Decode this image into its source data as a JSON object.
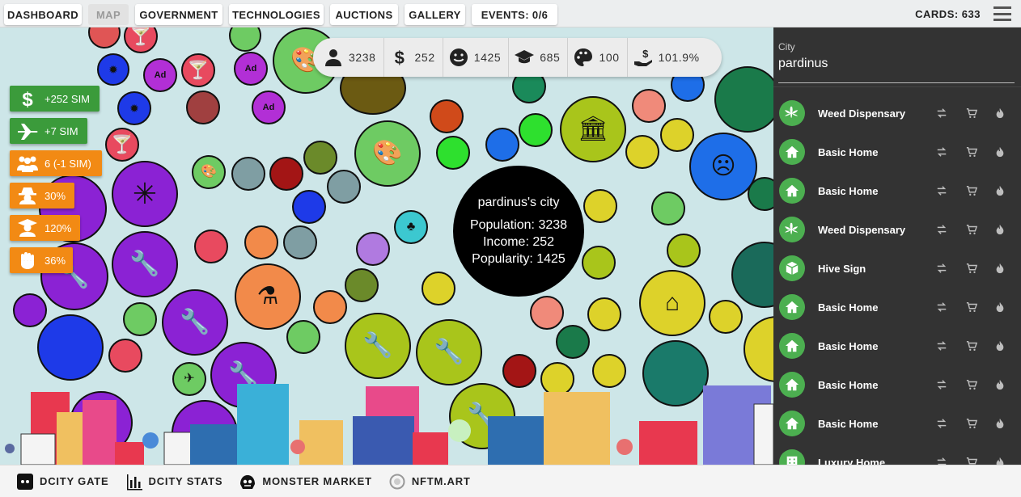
{
  "nav": {
    "dashboard": "DASHBOARD",
    "map": "MAP",
    "government": "GOVERNMENT",
    "technologies": "TECHNOLOGIES",
    "auctions": "AUCTIONS",
    "gallery": "GALLERY",
    "events": "EVENTS: 0/6",
    "cards": "CARDS: 633"
  },
  "stats": {
    "population": "3238",
    "income": "252",
    "popularity": "1425",
    "education": "685",
    "culture": "100",
    "tax": "101.9%"
  },
  "sidepills": [
    {
      "label": "+252 SIM",
      "icon": "dollar-icon",
      "color": "#3b9b3b"
    },
    {
      "label": "+7 SIM",
      "icon": "airplane-icon",
      "color": "#3b9b3b"
    },
    {
      "label": "6 (-1 SIM)",
      "icon": "people-icon",
      "color": "#f28a14"
    },
    {
      "label": "30%",
      "icon": "spy-icon",
      "color": "#f28a14"
    },
    {
      "label": "120%",
      "icon": "graduate-icon",
      "color": "#f28a14"
    },
    {
      "label": "36%",
      "icon": "fist-icon",
      "color": "#f28a14"
    }
  ],
  "cityinfo": {
    "title": "pardinus's city",
    "population": "Population: 3238",
    "income": "Income: 252",
    "popularity": "Popularity: 1425"
  },
  "panel": {
    "city_label": "City",
    "city_value": "pardinus",
    "items": [
      {
        "name": "Weed Dispensary",
        "icon": "leaf-icon"
      },
      {
        "name": "Basic Home",
        "icon": "home-icon"
      },
      {
        "name": "Basic Home",
        "icon": "home-icon"
      },
      {
        "name": "Weed Dispensary",
        "icon": "leaf-icon"
      },
      {
        "name": "Hive Sign",
        "icon": "cube-icon"
      },
      {
        "name": "Basic Home",
        "icon": "home-icon"
      },
      {
        "name": "Basic Home",
        "icon": "home-icon"
      },
      {
        "name": "Basic Home",
        "icon": "home-icon"
      },
      {
        "name": "Basic Home",
        "icon": "home-icon"
      },
      {
        "name": "Luxury Home",
        "icon": "building-icon"
      }
    ]
  },
  "footer": {
    "gate": "DCITY GATE",
    "stats": "DCITY STATS",
    "market": "MONSTER MARKET",
    "nftm": "NFTM.ART"
  },
  "colors": {
    "map_bg": "#cde6e8",
    "panel_bg": "#333333",
    "accent_green": "#4caf50",
    "pill_green": "#3b9b3b",
    "pill_orange": "#f28a14"
  }
}
